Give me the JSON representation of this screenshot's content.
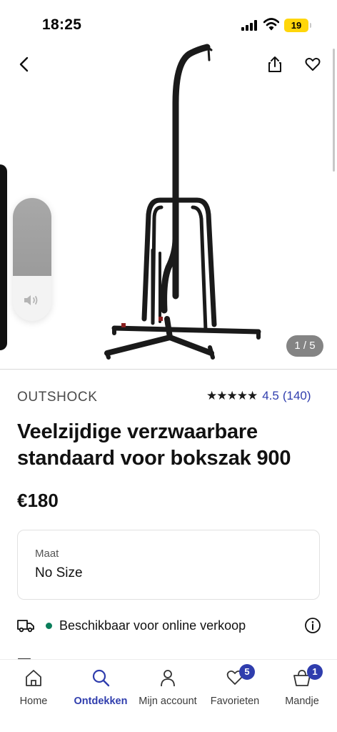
{
  "status_bar": {
    "time": "18:25",
    "battery": "19"
  },
  "gallery": {
    "counter": "1 / 5"
  },
  "product": {
    "brand": "OUTSHOCK",
    "rating": {
      "stars": "★★★★★",
      "value": "4.5",
      "count": "(140)"
    },
    "title": "Veelzijdige verzwaarbare standaard voor bokszak 900",
    "price": "€180"
  },
  "size_selector": {
    "label": "Maat",
    "value": "No Size"
  },
  "availability": {
    "text": "Beschikbaar voor online verkoop",
    "status_color": "#0a7d5a"
  },
  "tab_bar": {
    "tabs": [
      {
        "label": "Home",
        "icon": "home-icon",
        "active": false
      },
      {
        "label": "Ontdekken",
        "icon": "search-icon",
        "active": true
      },
      {
        "label": "Mijn account",
        "icon": "person-icon",
        "active": false
      },
      {
        "label": "Favorieten",
        "icon": "heart-icon",
        "badge": "5",
        "active": false
      },
      {
        "label": "Mandje",
        "icon": "basket-icon",
        "badge": "1",
        "active": false
      }
    ]
  },
  "colors": {
    "accent": "#2f3dad",
    "text": "#111111",
    "available": "#0a7d5a"
  }
}
